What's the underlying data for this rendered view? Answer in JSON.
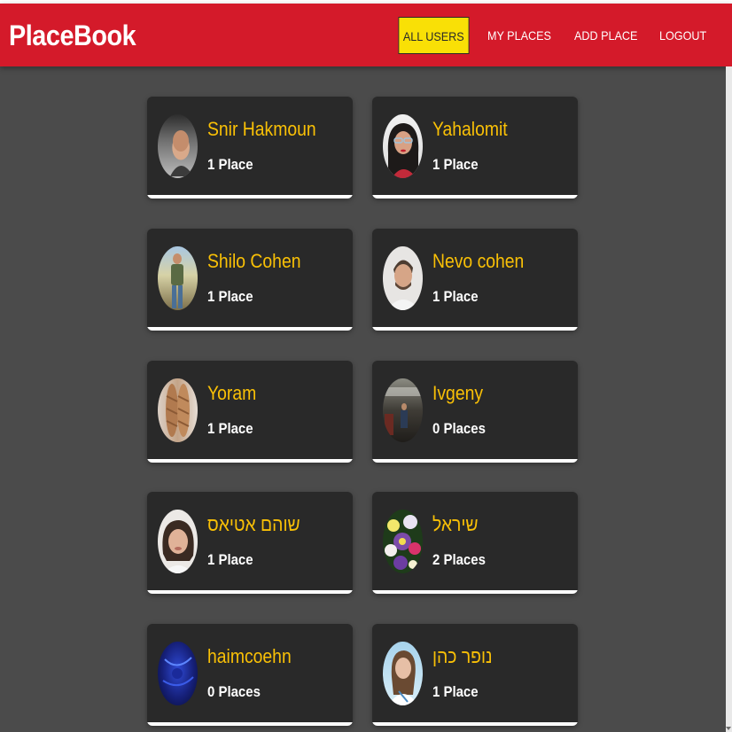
{
  "header": {
    "brand": "PlaceBook",
    "nav": [
      {
        "label": "ALL USERS",
        "active": true
      },
      {
        "label": "MY PLACES",
        "active": false
      },
      {
        "label": "ADD PLACE",
        "active": false
      },
      {
        "label": "LOGOUT",
        "active": false
      }
    ]
  },
  "users": [
    {
      "name": "Snir Hakmoun",
      "places": "1 Place"
    },
    {
      "name": "Yahalomit",
      "places": "1 Place"
    },
    {
      "name": "Shilo Cohen",
      "places": "1 Place"
    },
    {
      "name": "Nevo cohen",
      "places": "1 Place"
    },
    {
      "name": "Yoram",
      "places": "1 Place"
    },
    {
      "name": "Ivgeny",
      "places": "0 Places"
    },
    {
      "name": "שוהם אטיאס",
      "places": "1 Place"
    },
    {
      "name": "שיראל",
      "places": "2 Places"
    },
    {
      "name": "haimcoehn",
      "places": "0 Places"
    },
    {
      "name": "נופר כהן",
      "places": "1 Place"
    }
  ],
  "colors": {
    "header": "#d41a2a",
    "background": "#4b4b4b",
    "card": "#292929",
    "name": "#f9c006",
    "active_nav": "#f9e006"
  }
}
